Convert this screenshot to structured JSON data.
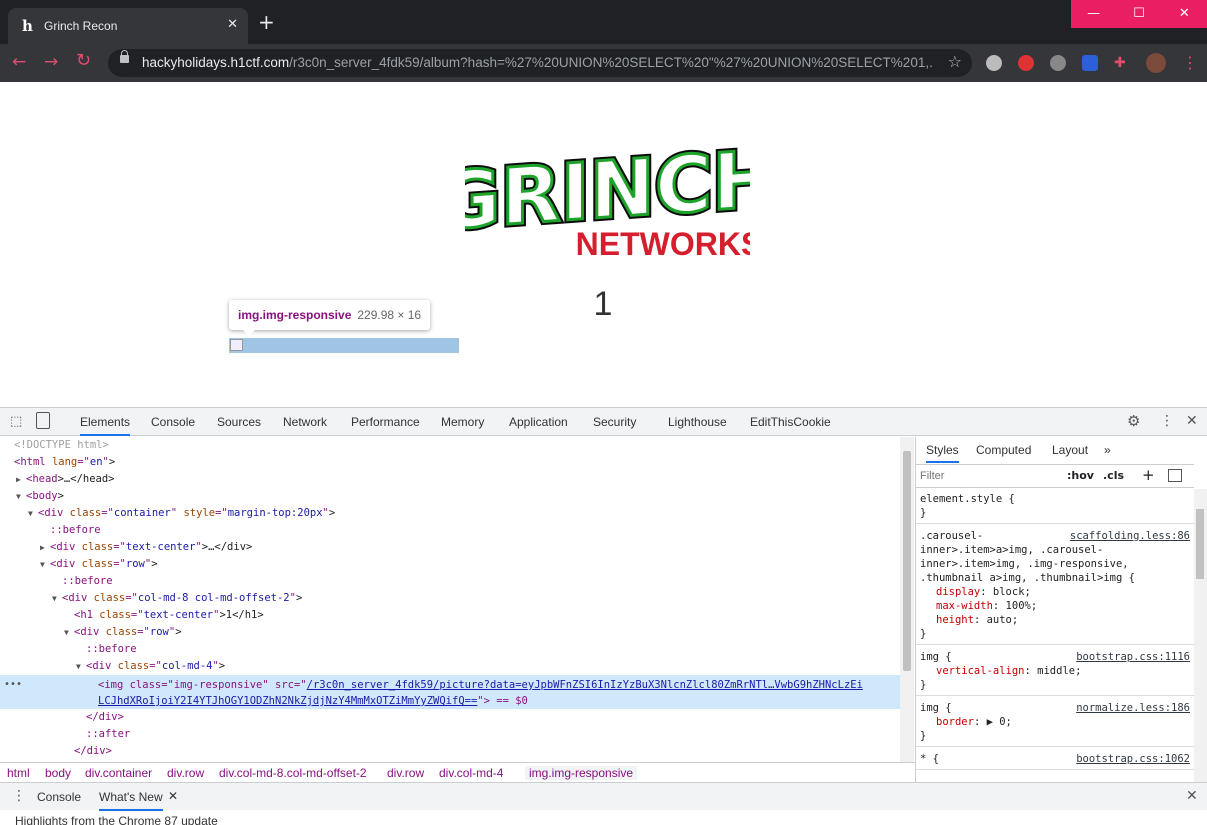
{
  "browser": {
    "tab_title": "Grinch Recon",
    "tab_favicon": "h",
    "new_tab_label": "+",
    "url_host": "hackyholidays.h1ctf.com",
    "url_path": "/r3c0n_server_4fdk59/album?hash=%27%20UNION%20SELECT%20\"%27%20UNION%20SELECT%201,...",
    "window_controls": [
      "—",
      "☐",
      "✕"
    ],
    "accent": "#e91e63"
  },
  "page": {
    "logo_top": "GRINCH",
    "logo_bottom": "NETWORKS",
    "heading": "1",
    "tooltip_tag": "img.img-responsive",
    "tooltip_dims": "229.98 × 16"
  },
  "devtools": {
    "tabs": [
      "Elements",
      "Console",
      "Sources",
      "Network",
      "Performance",
      "Memory",
      "Application",
      "Security",
      "Lighthouse",
      "EditThisCookie"
    ],
    "active_tab": "Elements",
    "dom_lines": [
      {
        "indent": 0,
        "arrow": "",
        "html": "<!DOCTYPE html>"
      },
      {
        "indent": 0,
        "arrow": "",
        "html": "<html lang=\"en\">"
      },
      {
        "indent": 1,
        "arrow": "▶",
        "html": "<head>…</head>"
      },
      {
        "indent": 1,
        "arrow": "▼",
        "html": "<body>"
      },
      {
        "indent": 2,
        "arrow": "▼",
        "html": "<div class=\"container\" style=\"margin-top:20px\">"
      },
      {
        "indent": 3,
        "arrow": "",
        "html": "::before"
      },
      {
        "indent": 3,
        "arrow": "▶",
        "html": "<div class=\"text-center\">…</div>"
      },
      {
        "indent": 3,
        "arrow": "▼",
        "html": "<div class=\"row\">"
      },
      {
        "indent": 4,
        "arrow": "",
        "html": "::before"
      },
      {
        "indent": 4,
        "arrow": "▼",
        "html": "<div class=\"col-md-8 col-md-offset-2\">"
      },
      {
        "indent": 5,
        "arrow": "",
        "html": "<h1 class=\"text-center\">1</h1>"
      },
      {
        "indent": 5,
        "arrow": "▼",
        "html": "<div class=\"row\">"
      },
      {
        "indent": 6,
        "arrow": "",
        "html": "::before"
      },
      {
        "indent": 6,
        "arrow": "▼",
        "html": "<div class=\"col-md-4\">"
      }
    ],
    "selected_line1_tag": "<img class=\"img-responsive\" src=\"",
    "selected_line1_link": "/r3c0n_server_4fdk59/picture?data=eyJpbWFnZSI6InIzYzBuX3NlcnZlcl80ZmRrNTl…VwbG9hZHNcLzEi",
    "selected_line2_link": "LCJhdXRoIjoiY2I4YTJhOGY1ODZhN2NkZjdjNzY4MmMxOTZiMmYyZWQifQ==",
    "selected_line2_tail": "\"> == $0",
    "after_lines": [
      {
        "indent": 6,
        "html": "</div>"
      },
      {
        "indent": 6,
        "html": "::after"
      },
      {
        "indent": 5,
        "html": "</div>"
      }
    ],
    "breadcrumbs": [
      "html",
      "body",
      "div.container",
      "div.row",
      "div.col-md-8.col-md-offset-2",
      "div.row",
      "div.col-md-4",
      "img.img-responsive"
    ],
    "styles_tabs": [
      "Styles",
      "Computed",
      "Layout",
      "»"
    ],
    "filter_placeholder": "Filter",
    "hov_label": ":hov",
    "cls_label": ".cls",
    "rules": [
      {
        "selector": "element.style {",
        "body": [
          "}"
        ],
        "src": ""
      },
      {
        "selector": ".carousel-\ninner>.item>a>img, .carousel-\ninner>.item>img, .img-responsive,\n.thumbnail a>img, .thumbnail>img {",
        "body": [
          "display: block;",
          "max-width: 100%;",
          "height: auto;"
        ],
        "src": "scaffolding.less:86"
      },
      {
        "selector": "img {",
        "body": [
          "vertical-align: middle;"
        ],
        "src": "bootstrap.css:1116"
      },
      {
        "selector": "img {",
        "body": [
          "border: ▶ 0;"
        ],
        "src": "normalize.less:186"
      },
      {
        "selector": "* {",
        "body": [],
        "src": "bootstrap.css:1062"
      }
    ],
    "drawer_tabs": [
      "Console",
      "What's New"
    ],
    "drawer_text": "Highlights from the Chrome 87 update"
  }
}
